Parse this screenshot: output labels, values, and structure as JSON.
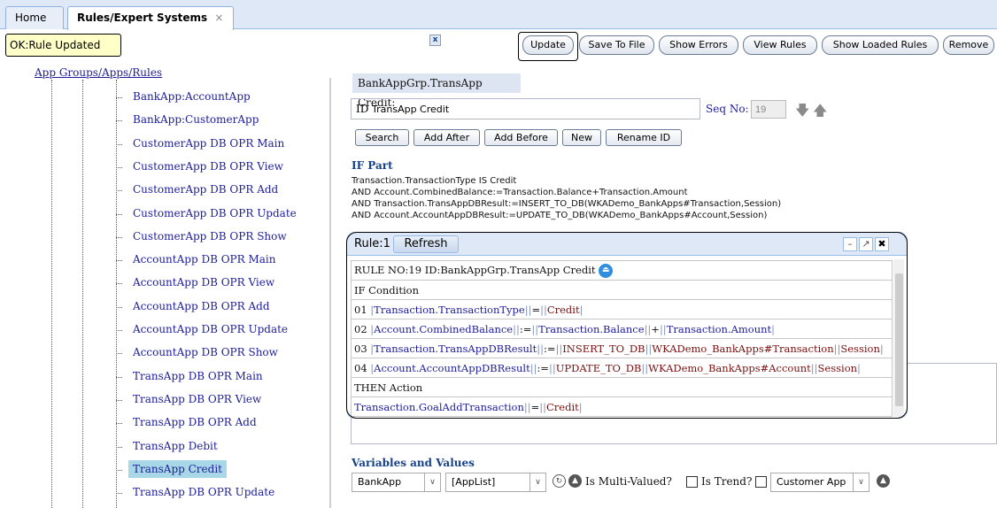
{
  "tabs": {
    "home": "Home",
    "active": "Rules/Expert Systems",
    "close": "×"
  },
  "status": {
    "message": "OK:Rule Updated",
    "close": "x"
  },
  "toolbar": {
    "update": "Update",
    "save_to_file": "Save To File",
    "show_errors": "Show Errors",
    "view_rules": "View Rules",
    "show_loaded_rules": "Show Loaded Rules",
    "remove": "Remove"
  },
  "tree": {
    "root": "App Groups/Apps/Rules",
    "items": [
      "BankApp:AccountApp",
      "BankApp:CustomerApp",
      "CustomerApp DB OPR Main",
      "CustomerApp DB OPR View",
      "CustomerApp DB OPR Add",
      "CustomerApp DB OPR Update",
      "CustomerApp DB OPR Show",
      "AccountApp DB OPR Main",
      "AccountApp DB OPR View",
      "AccountApp DB OPR Add",
      "AccountApp DB OPR Update",
      "AccountApp DB OPR Show",
      "TransApp DB OPR Main",
      "TransApp DB OPR View",
      "TransApp DB OPR Add",
      "TransApp Debit",
      "TransApp Credit",
      "TransApp DB OPR Update"
    ],
    "selected": "TransApp Credit"
  },
  "rule": {
    "header": "BankAppGrp.TransApp Credit:",
    "id_label": "ID",
    "id_value": "TransApp Credit",
    "seq_label": "Seq No:",
    "seq_value": "19"
  },
  "actions": {
    "search": "Search",
    "add_after": "Add After",
    "add_before": "Add Before",
    "new": "New",
    "rename_id": "Rename ID"
  },
  "if_part": {
    "title": "IF Part",
    "lines": [
      "Transaction.TransactionType IS Credit",
      "AND Account.CombinedBalance:=Transaction.Balance+Transaction.Amount",
      "AND Transaction.TransAppDBResult:=INSERT_TO_DB(WKADemo_BankApps#Transaction,Session)",
      "AND Account.AccountAppDBResult:=UPDATE_TO_DB(WKADemo_BankApps#Account,Session)"
    ]
  },
  "popup": {
    "title": "Rule:1",
    "refresh": "Refresh",
    "rule_no": "RULE NO:19 ID:BankAppGrp.TransApp Credit",
    "if_condition": "IF Condition",
    "then_action": "THEN Action",
    "conditions": [
      {
        "num": "01 ",
        "p1": "Transaction.TransactionType",
        "op": "=",
        "p2": "Credit",
        "p3": "",
        "p4": ""
      },
      {
        "num": "02 ",
        "p1": "Account.CombinedBalance",
        "op": ":=",
        "p2": "Transaction.Balance",
        "p3": "+",
        "p4": "Transaction.Amount"
      },
      {
        "num": "03 ",
        "p1": "Transaction.TransAppDBResult",
        "op": ":=",
        "p2": "INSERT_TO_DB",
        "p3": "WKADemo_BankApps#Transaction",
        "p4": "Session"
      },
      {
        "num": "04 ",
        "p1": "Account.AccountAppDBResult",
        "op": ":=",
        "p2": "UPDATE_TO_DB",
        "p3": "WKADemo_BankApps#Account",
        "p4": "Session"
      }
    ],
    "action": {
      "p1": "Transaction.GoalAddTransaction",
      "op": "=",
      "p2": "Credit"
    }
  },
  "variables": {
    "title": "Variables and Values",
    "app": "BankApp",
    "applist": "[AppList]",
    "multi_valued": "Is Multi-Valued?",
    "is_trend": "Is Trend?",
    "customer_app": "Customer App"
  }
}
